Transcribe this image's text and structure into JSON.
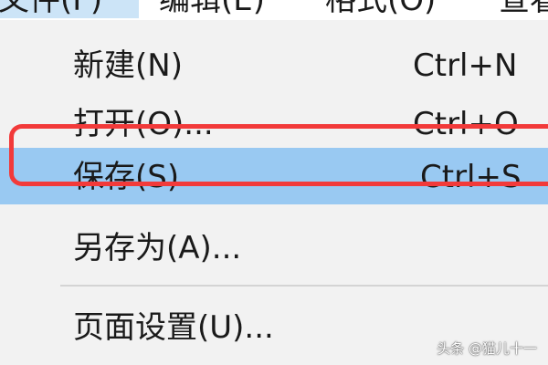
{
  "menubar": {
    "items": [
      {
        "label": "文件(F)"
      },
      {
        "label": "编辑(E)"
      },
      {
        "label": "格式(O)"
      },
      {
        "label": "查看"
      }
    ]
  },
  "menu": {
    "items": [
      {
        "label": "新建(N)",
        "shortcut": "Ctrl+N"
      },
      {
        "label": "打开(O)...",
        "shortcut": "Ctrl+O"
      },
      {
        "label": "保存(S)",
        "shortcut": "Ctrl+S",
        "highlighted": true
      },
      {
        "label": "另存为(A)...",
        "shortcut": ""
      },
      {
        "label": "页面设置(U)...",
        "shortcut": ""
      }
    ]
  },
  "watermark": {
    "text": "头条 @猫儿十一"
  },
  "colors": {
    "highlight": "#99c9f2",
    "annotation_ring": "#f23a3a",
    "menu_bg": "#f2f2f2",
    "menubar_active": "#cce4f7"
  }
}
